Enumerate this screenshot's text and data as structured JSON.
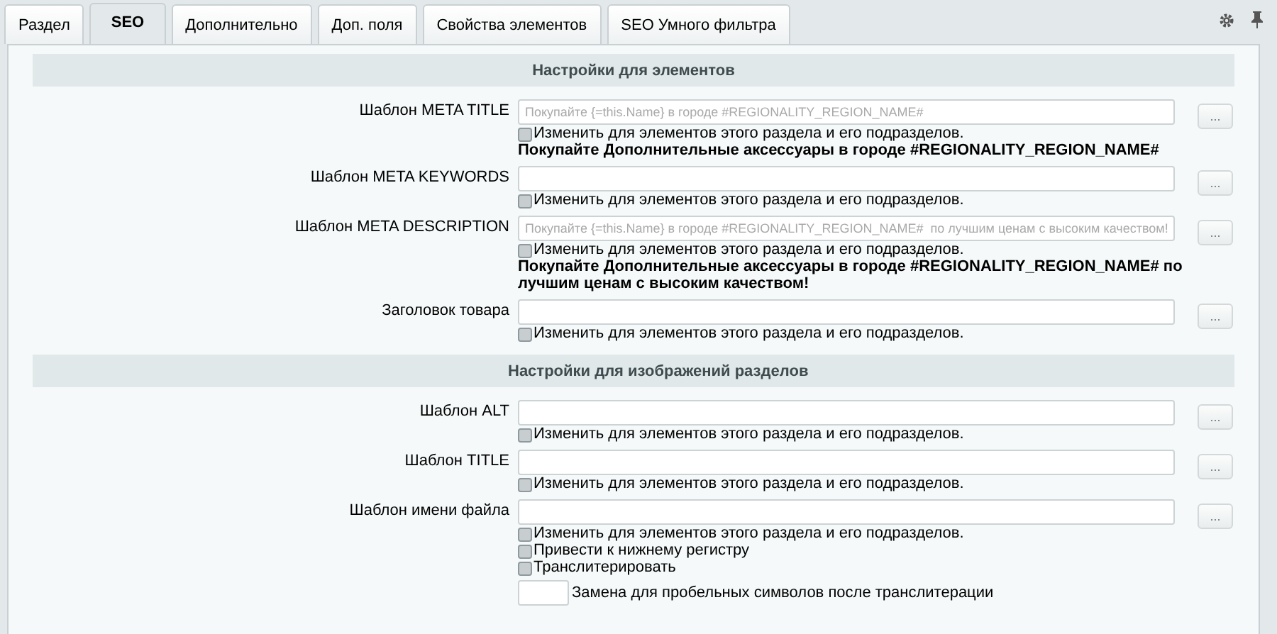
{
  "tabs": [
    {
      "label": "Раздел",
      "selected": false
    },
    {
      "label": "SEO",
      "selected": true
    },
    {
      "label": "Дополнительно",
      "selected": false
    },
    {
      "label": "Доп. поля",
      "selected": false
    },
    {
      "label": "Свойства элементов",
      "selected": false
    },
    {
      "label": "SEO Умного фильтра",
      "selected": false
    }
  ],
  "sections": [
    {
      "title": "Настройки для элементов",
      "fields": [
        {
          "label": "Шаблон META TITLE",
          "placeholder": "Покупайте {=this.Name} в городе #REGIONALITY_REGION_NAME#",
          "button": "...",
          "options": [
            {
              "label": "Изменить для элементов этого раздела и его подразделов.",
              "checked": false
            }
          ],
          "preview": "Покупайте Дополнительные аксессуары в городе #REGIONALITY_REGION_NAME#"
        },
        {
          "label": "Шаблон META KEYWORDS",
          "button": "...",
          "options": [
            {
              "label": "Изменить для элементов этого раздела и его подразделов.",
              "checked": false
            }
          ]
        },
        {
          "label": "Шаблон META DESCRIPTION",
          "placeholder": "Покупайте {=this.Name} в городе #REGIONALITY_REGION_NAME#  по лучшим ценам с высоким качеством!",
          "button": "...",
          "options": [
            {
              "label": "Изменить для элементов этого раздела и его подразделов.",
              "checked": false
            }
          ],
          "preview": "Покупайте Дополнительные аксессуары в городе #REGIONALITY_REGION_NAME# по лучшим ценам с высоким качеством!"
        },
        {
          "label": "Заголовок товара",
          "button": "...",
          "options": [
            {
              "label": "Изменить для элементов этого раздела и его подразделов.",
              "checked": false
            }
          ]
        }
      ]
    },
    {
      "title": "Настройки для изображений разделов",
      "fields": [
        {
          "label": "Шаблон ALT",
          "button": "...",
          "options": [
            {
              "label": "Изменить для элементов этого раздела и его подразделов.",
              "checked": false
            }
          ]
        },
        {
          "label": "Шаблон TITLE",
          "button": "...",
          "options": [
            {
              "label": "Изменить для элементов этого раздела и его подразделов.",
              "checked": false
            }
          ]
        },
        {
          "label": "Шаблон имени файла",
          "button": "...",
          "options": [
            {
              "label": "Изменить для элементов этого раздела и его подразделов.",
              "checked": false
            },
            {
              "label": "Привести к нижнему регистру",
              "checked": false
            },
            {
              "label": "Транслитерировать",
              "checked": false
            }
          ],
          "space_replacement": {
            "label": "Замена для пробельных символов после транслитерации"
          }
        }
      ]
    }
  ]
}
